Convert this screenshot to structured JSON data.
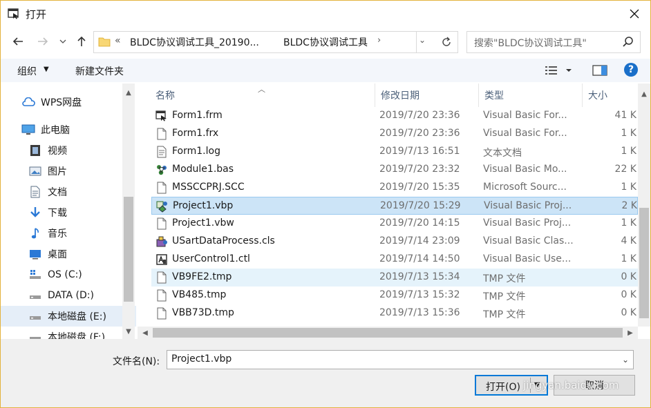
{
  "window": {
    "title": "打开"
  },
  "address": {
    "overflow_glyph": "«",
    "segments": [
      "BLDC协议调试工具_20190...",
      "BLDC协议调试工具"
    ],
    "search_placeholder": "搜索\"BLDC协议调试工具\""
  },
  "toolbar": {
    "organize_label": "组织",
    "new_folder_label": "新建文件夹"
  },
  "nav": {
    "items": [
      {
        "label": "WPS网盘",
        "icon": "cloud-icon"
      },
      {
        "label": "此电脑",
        "icon": "computer-icon"
      },
      {
        "label": "视频",
        "icon": "video-icon"
      },
      {
        "label": "图片",
        "icon": "pictures-icon"
      },
      {
        "label": "文档",
        "icon": "documents-icon"
      },
      {
        "label": "下载",
        "icon": "download-icon"
      },
      {
        "label": "音乐",
        "icon": "music-icon"
      },
      {
        "label": "桌面",
        "icon": "desktop-icon"
      },
      {
        "label": "OS (C:)",
        "icon": "os-drive-icon"
      },
      {
        "label": "DATA (D:)",
        "icon": "drive-icon"
      },
      {
        "label": "本地磁盘 (E:)",
        "icon": "drive-icon"
      },
      {
        "label": "本地磁盘 (F:)",
        "icon": "drive-icon"
      }
    ]
  },
  "columns": {
    "name": "名称",
    "date": "修改日期",
    "type": "类型",
    "size": "大小"
  },
  "files": [
    {
      "name": "Form1.frm",
      "date": "2019/7/20 23:36",
      "type": "Visual Basic For...",
      "size": "41 K",
      "icon": "vb-form-icon"
    },
    {
      "name": "Form1.frx",
      "date": "2019/7/20 23:36",
      "type": "Visual Basic For...",
      "size": "1 K",
      "icon": "file-icon"
    },
    {
      "name": "Form1.log",
      "date": "2019/7/13 16:51",
      "type": "文本文档",
      "size": "1 K",
      "icon": "text-file-icon"
    },
    {
      "name": "Module1.bas",
      "date": "2019/7/20 23:32",
      "type": "Visual Basic Mo...",
      "size": "22 K",
      "icon": "vb-module-icon"
    },
    {
      "name": "MSSCCPRJ.SCC",
      "date": "2019/7/20 15:35",
      "type": "Microsoft Sourc...",
      "size": "1 K",
      "icon": "file-icon"
    },
    {
      "name": "Project1.vbp",
      "date": "2019/7/20 15:29",
      "type": "Visual Basic Proj...",
      "size": "2 K",
      "icon": "vb-project-icon"
    },
    {
      "name": "Project1.vbw",
      "date": "2019/7/20 14:15",
      "type": "Visual Basic Proj...",
      "size": "1 K",
      "icon": "file-icon"
    },
    {
      "name": "USartDataProcess.cls",
      "date": "2019/7/14 23:09",
      "type": "Visual Basic Clas...",
      "size": "4 K",
      "icon": "vb-class-icon"
    },
    {
      "name": "UserControl1.ctl",
      "date": "2019/7/14 14:50",
      "type": "Visual Basic Use...",
      "size": "1 K",
      "icon": "vb-usercontrol-icon"
    },
    {
      "name": "VB9FE2.tmp",
      "date": "2019/7/13 15:34",
      "type": "TMP 文件",
      "size": "0 K",
      "icon": "file-icon"
    },
    {
      "name": "VB485.tmp",
      "date": "2019/7/13 15:32",
      "type": "TMP 文件",
      "size": "0 K",
      "icon": "file-icon"
    },
    {
      "name": "VBB73D.tmp",
      "date": "2019/7/13 15:36",
      "type": "TMP 文件",
      "size": "0 K",
      "icon": "file-icon"
    }
  ],
  "selected_file": "Project1.vbp",
  "filename": {
    "label": "文件名(N):",
    "value": "Project1.vbp"
  },
  "buttons": {
    "open": "打开(O)",
    "cancel": "取消"
  },
  "watermark": "jingyan.baidu.com",
  "colors": {
    "accent": "#0078d7",
    "selection": "#cce4f7",
    "hover": "#e5f3fb",
    "window_border": "#e3b23c"
  }
}
